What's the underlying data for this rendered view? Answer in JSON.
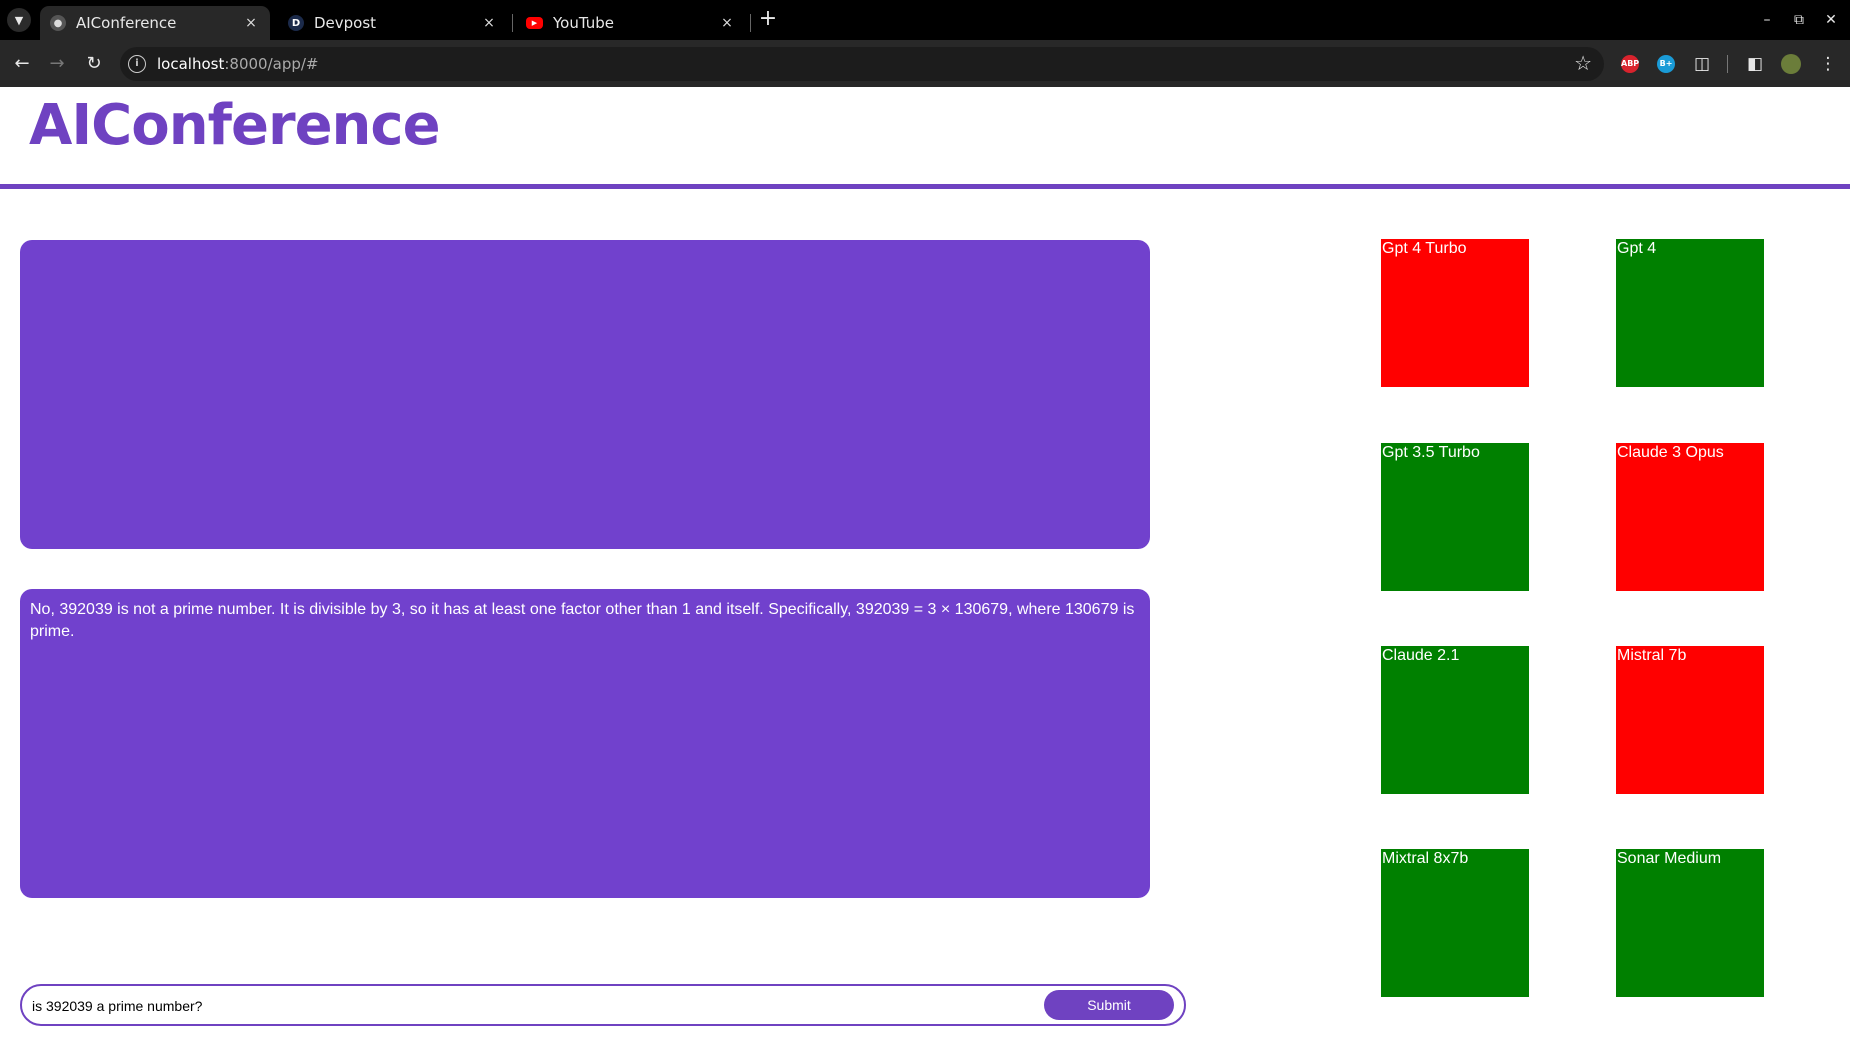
{
  "browser": {
    "tabs": [
      {
        "title": "AIConference",
        "favicon": "globe-icon",
        "active": true
      },
      {
        "title": "Devpost",
        "favicon": "devpost-icon",
        "active": false
      },
      {
        "title": "YouTube",
        "favicon": "youtube-icon",
        "active": false
      }
    ],
    "close_glyph": "×",
    "new_tab_glyph": "+",
    "url_host": "localhost",
    "url_path": ":8000/app/#",
    "extensions": [
      {
        "name": "ABP",
        "color": "#d9232d"
      },
      {
        "name": "B+",
        "color": "#1a9bd7"
      }
    ]
  },
  "app": {
    "title": "AIConference",
    "accent_color": "#6f42c1",
    "panels": [
      {
        "text": ""
      },
      {
        "text": "No, 392039 is not a prime number. It is divisible by 3, so it has at least one factor other than 1 and itself. Specifically, 392039 = 3 × 130679, where 130679 is prime."
      }
    ],
    "prompt": {
      "value": "is 392039 a prime number?",
      "submit_label": "Submit"
    },
    "models": [
      {
        "name": "Gpt 4 Turbo",
        "status": "red",
        "color": "#ff0000"
      },
      {
        "name": "Gpt 4",
        "status": "green",
        "color": "#008000"
      },
      {
        "name": "Gpt 3.5 Turbo",
        "status": "green",
        "color": "#008000"
      },
      {
        "name": "Claude 3 Opus",
        "status": "red",
        "color": "#ff0000"
      },
      {
        "name": "Claude 2.1",
        "status": "green",
        "color": "#008000"
      },
      {
        "name": "Mistral 7b",
        "status": "red",
        "color": "#ff0000"
      },
      {
        "name": "Mixtral 8x7b",
        "status": "green",
        "color": "#008000"
      },
      {
        "name": "Sonar Medium",
        "status": "green",
        "color": "#008000"
      }
    ]
  }
}
